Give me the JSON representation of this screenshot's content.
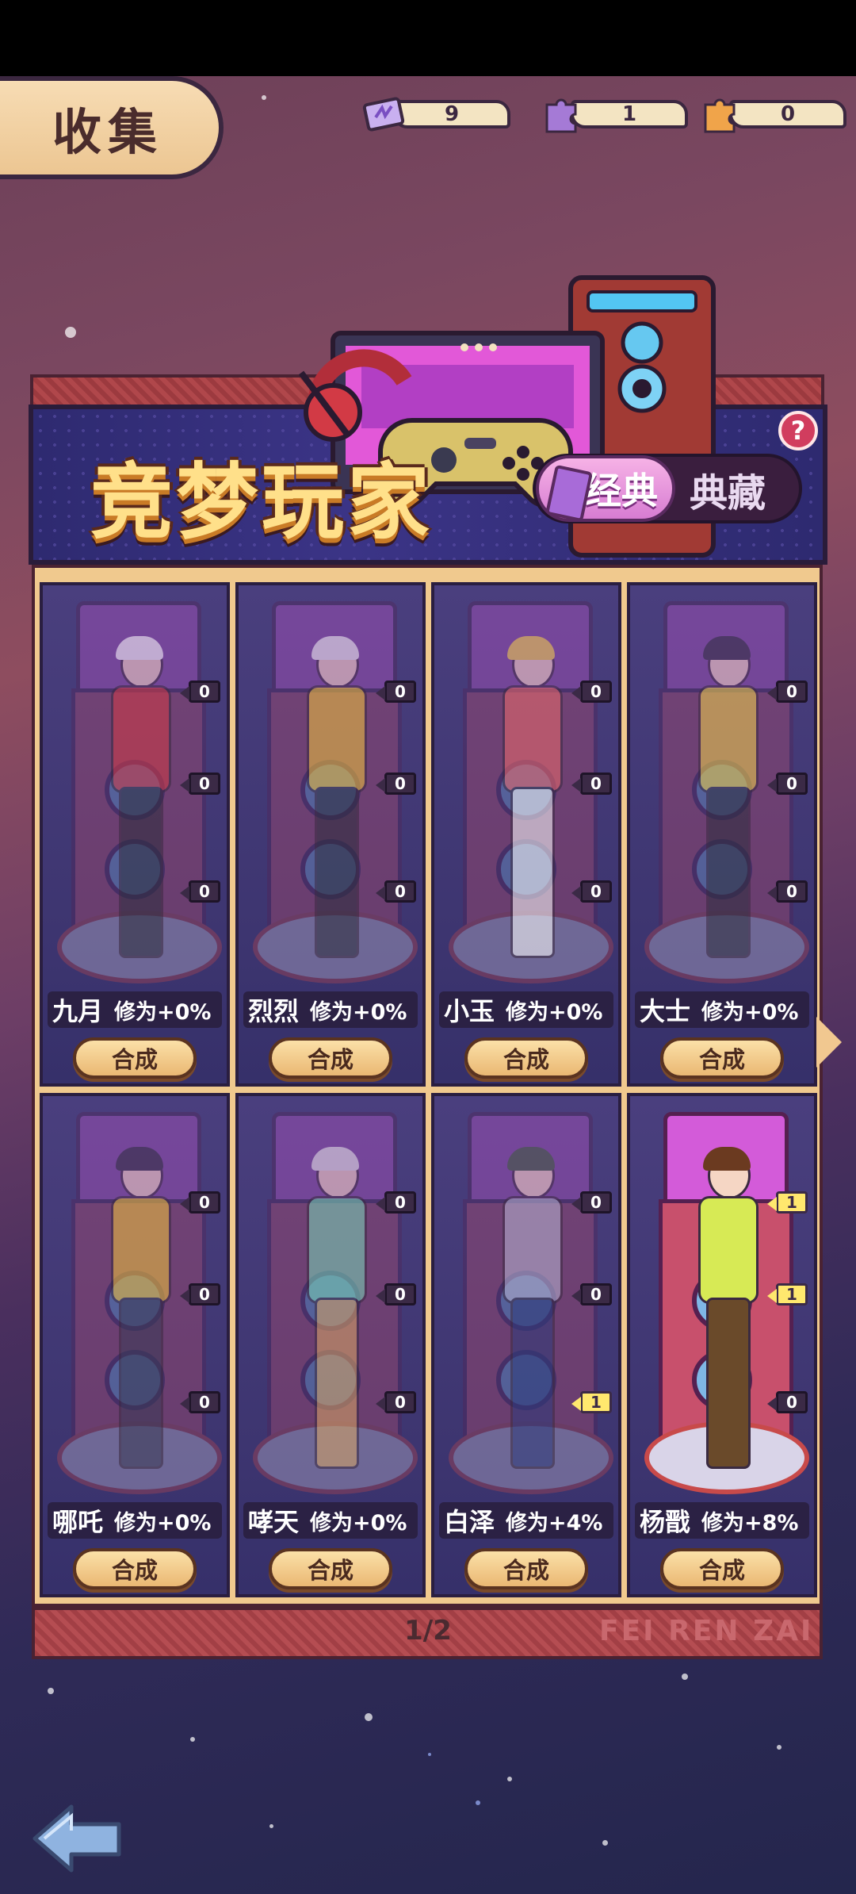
{
  "screen_title": "收集",
  "currencies": [
    {
      "name": "ticket-icon",
      "value": "9",
      "color": "#b99ae6"
    },
    {
      "name": "puzzle-purple-icon",
      "value": "1",
      "color": "#a57ad6"
    },
    {
      "name": "puzzle-orange-icon",
      "value": "0",
      "color": "#f0a44a"
    }
  ],
  "banner": {
    "title": "竞梦玩家",
    "tabs": [
      {
        "label": "经典",
        "active": true
      },
      {
        "label": "典藏",
        "active": false
      }
    ],
    "help": "?"
  },
  "cards": [
    {
      "name": "九月",
      "cultivation": "修为+0%",
      "counts": [
        "0",
        "0",
        "0"
      ],
      "lit": [
        false,
        false,
        false
      ],
      "owned": false,
      "merge": "合成"
    },
    {
      "name": "烈烈",
      "cultivation": "修为+0%",
      "counts": [
        "0",
        "0",
        "0"
      ],
      "lit": [
        false,
        false,
        false
      ],
      "owned": false,
      "merge": "合成"
    },
    {
      "name": "小玉",
      "cultivation": "修为+0%",
      "counts": [
        "0",
        "0",
        "0"
      ],
      "lit": [
        false,
        false,
        false
      ],
      "owned": false,
      "merge": "合成"
    },
    {
      "name": "大士",
      "cultivation": "修为+0%",
      "counts": [
        "0",
        "0",
        "0"
      ],
      "lit": [
        false,
        false,
        false
      ],
      "owned": false,
      "merge": "合成"
    },
    {
      "name": "哪吒",
      "cultivation": "修为+0%",
      "counts": [
        "0",
        "0",
        "0"
      ],
      "lit": [
        false,
        false,
        false
      ],
      "owned": false,
      "merge": "合成"
    },
    {
      "name": "哮天",
      "cultivation": "修为+0%",
      "counts": [
        "0",
        "0",
        "0"
      ],
      "lit": [
        false,
        false,
        false
      ],
      "owned": false,
      "merge": "合成"
    },
    {
      "name": "白泽",
      "cultivation": "修为+4%",
      "counts": [
        "0",
        "0",
        "1"
      ],
      "lit": [
        false,
        false,
        true
      ],
      "owned": false,
      "merge": "合成"
    },
    {
      "name": "杨戬",
      "cultivation": "修为+8%",
      "counts": [
        "1",
        "1",
        "0"
      ],
      "lit": [
        true,
        true,
        false
      ],
      "owned": true,
      "merge": "合成"
    }
  ],
  "pagination": "1/2",
  "watermark": "FEI REN ZAI"
}
